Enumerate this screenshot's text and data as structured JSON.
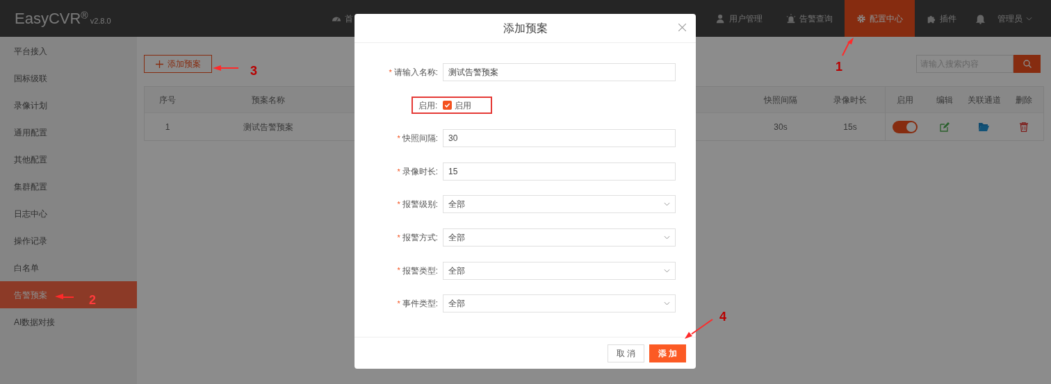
{
  "header": {
    "logo": "EasyCVR",
    "logo_mark": "®",
    "version": "v2.8.0",
    "nav": [
      {
        "label": "首",
        "selected": false
      },
      {
        "label": "用户管理",
        "selected": false
      },
      {
        "label": "告警查询",
        "selected": false
      },
      {
        "label": "配置中心",
        "selected": true
      },
      {
        "label": "插件",
        "selected": false
      }
    ],
    "user": "管理员"
  },
  "sidebar": {
    "items": [
      {
        "label": "平台接入",
        "selected": false
      },
      {
        "label": "国标级联",
        "selected": false
      },
      {
        "label": "录像计划",
        "selected": false
      },
      {
        "label": "通用配置",
        "selected": false
      },
      {
        "label": "其他配置",
        "selected": false
      },
      {
        "label": "集群配置",
        "selected": false
      },
      {
        "label": "日志中心",
        "selected": false
      },
      {
        "label": "操作记录",
        "selected": false
      },
      {
        "label": "白名单",
        "selected": false
      },
      {
        "label": "告警预案",
        "selected": true
      },
      {
        "label": "AI数据对接",
        "selected": false
      }
    ]
  },
  "toolbar": {
    "add_button": "添加预案",
    "search": {
      "placeholder": "请输入搜索内容"
    }
  },
  "table": {
    "columns": [
      "序号",
      "预案名称",
      "快照间隔",
      "录像时长",
      "启用",
      "编辑",
      "关联通道",
      "删除"
    ],
    "rows": [
      {
        "index": "1",
        "name": "测试告警预案",
        "snapshot_interval": "30s",
        "record_duration": "15s",
        "enabled": true
      }
    ]
  },
  "dialog": {
    "title": "添加预案",
    "required_mark": "*",
    "fields": [
      {
        "kind": "text",
        "label": "请输入名称:",
        "required": true,
        "value": "测试告警预案"
      },
      {
        "kind": "checkbox",
        "label": "启用:",
        "required": false,
        "option": "启用",
        "checked": true
      },
      {
        "kind": "text",
        "label": "快照间隔:",
        "required": true,
        "value": "30"
      },
      {
        "kind": "text",
        "label": "录像时长:",
        "required": true,
        "value": "15"
      },
      {
        "kind": "select",
        "label": "报警级别:",
        "required": true,
        "value": "全部"
      },
      {
        "kind": "select",
        "label": "报警方式:",
        "required": true,
        "value": "全部"
      },
      {
        "kind": "select",
        "label": "报警类型:",
        "required": true,
        "value": "全部"
      },
      {
        "kind": "select",
        "label": "事件类型:",
        "required": true,
        "value": "全部"
      }
    ],
    "buttons": [
      {
        "label": "取 消",
        "kind": "default"
      },
      {
        "label": "添 加",
        "kind": "primary"
      }
    ]
  },
  "annotations": [
    {
      "number": "1"
    },
    {
      "number": "2"
    },
    {
      "number": "3"
    },
    {
      "number": "4"
    }
  ]
}
